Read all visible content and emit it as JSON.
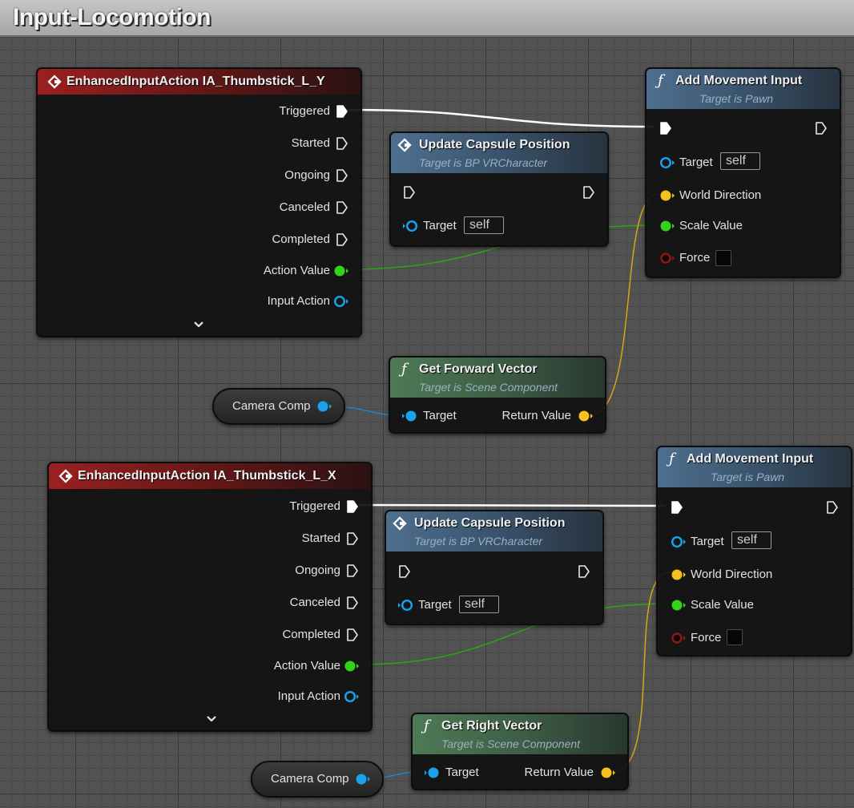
{
  "graph": {
    "title": "Input-Locomotion"
  },
  "colors": {
    "exec_wire": "#ffffff",
    "float_pin": "#35d11c",
    "vector_pin": "#f4c21b",
    "object_pin": "#1aa2ee",
    "bool_pin": "#8a1a1a",
    "event_header": "#9a2020",
    "function_header_blue": "#4e6f8f",
    "function_header_green": "#4e7a55"
  },
  "event_y": {
    "title": "EnhancedInputAction IA_Thumbstick_L_Y",
    "pins": [
      "Triggered",
      "Started",
      "Ongoing",
      "Canceled",
      "Completed",
      "Action Value",
      "Input Action"
    ]
  },
  "event_x": {
    "title": "EnhancedInputAction IA_Thumbstick_L_X",
    "pins": [
      "Triggered",
      "Started",
      "Ongoing",
      "Canceled",
      "Completed",
      "Action Value",
      "Input Action"
    ]
  },
  "capsule_1": {
    "title": "Update Capsule Position",
    "subtitle": "Target is BP VRCharacter",
    "target_label": "Target",
    "target_value": "self"
  },
  "capsule_2": {
    "title": "Update Capsule Position",
    "subtitle": "Target is BP VRCharacter",
    "target_label": "Target",
    "target_value": "self"
  },
  "add_move_1": {
    "title": "Add Movement Input",
    "subtitle": "Target is Pawn",
    "target_label": "Target",
    "target_value": "self",
    "world_direction": "World Direction",
    "scale_value": "Scale Value",
    "force": "Force"
  },
  "add_move_2": {
    "title": "Add Movement Input",
    "subtitle": "Target is Pawn",
    "target_label": "Target",
    "target_value": "self",
    "world_direction": "World Direction",
    "scale_value": "Scale Value",
    "force": "Force"
  },
  "forward": {
    "title": "Get Forward Vector",
    "subtitle": "Target is Scene Component",
    "target_label": "Target",
    "return_label": "Return Value"
  },
  "right": {
    "title": "Get Right Vector",
    "subtitle": "Target is Scene Component",
    "target_label": "Target",
    "return_label": "Return Value"
  },
  "camera_1": {
    "label": "Camera Comp"
  },
  "camera_2": {
    "label": "Camera Comp"
  },
  "icons": {
    "event": "event-diamond-icon",
    "function": "function-f-icon",
    "expand": "chevron-down-icon"
  }
}
